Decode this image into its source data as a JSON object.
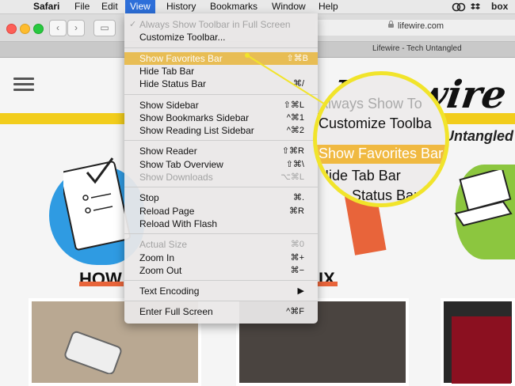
{
  "menubar": {
    "apple_glyph": "",
    "app_name": "Safari",
    "items": [
      "File",
      "Edit",
      "View",
      "History",
      "Bookmarks",
      "Window",
      "Help"
    ],
    "active": "View",
    "status_box": "box"
  },
  "toolbar": {
    "back_glyph": "‹",
    "forward_glyph": "›",
    "sidebar_glyph": "▭",
    "url": "lifewire.com",
    "tab_title": "Lifewire - Tech Untangled"
  },
  "page": {
    "logo_text": "Lifewire",
    "tagline": "Untangled",
    "heading_left": "HOW",
    "heading_right": "IX"
  },
  "view_menu": {
    "groups": [
      [
        {
          "label": "Always Show Toolbar in Full Screen",
          "shortcut": "",
          "disabled": true,
          "checked": true
        },
        {
          "label": "Customize Toolbar...",
          "shortcut": ""
        }
      ],
      [
        {
          "label": "Show Favorites Bar",
          "shortcut": "⇧⌘B",
          "highlighted": true
        },
        {
          "label": "Hide Tab Bar",
          "shortcut": ""
        },
        {
          "label": "Hide Status Bar",
          "shortcut": "⌘/"
        }
      ],
      [
        {
          "label": "Show Sidebar",
          "shortcut": "⇧⌘L"
        },
        {
          "label": "Show Bookmarks Sidebar",
          "shortcut": "^⌘1"
        },
        {
          "label": "Show Reading List Sidebar",
          "shortcut": "^⌘2"
        }
      ],
      [
        {
          "label": "Show Reader",
          "shortcut": "⇧⌘R"
        },
        {
          "label": "Show Tab Overview",
          "shortcut": "⇧⌘\\"
        },
        {
          "label": "Show Downloads",
          "shortcut": "⌥⌘L",
          "disabled": true
        }
      ],
      [
        {
          "label": "Stop",
          "shortcut": "⌘."
        },
        {
          "label": "Reload Page",
          "shortcut": "⌘R"
        },
        {
          "label": "Reload With Flash",
          "shortcut": ""
        }
      ],
      [
        {
          "label": "Actual Size",
          "shortcut": "⌘0",
          "disabled": true
        },
        {
          "label": "Zoom In",
          "shortcut": "⌘+"
        },
        {
          "label": "Zoom Out",
          "shortcut": "⌘−"
        }
      ],
      [
        {
          "label": "Text Encoding",
          "shortcut": "▶"
        }
      ],
      [
        {
          "label": "Enter Full Screen",
          "shortcut": "^⌘F"
        }
      ]
    ]
  },
  "magnifier": {
    "lines": [
      "Always Show To",
      "Customize Toolba",
      "Show Favorites Bar",
      "Hide Tab Bar",
      "Hide Status Bar"
    ]
  },
  "colors": {
    "highlight": "#e8b945",
    "callout": "#f1e42b",
    "brand_yellow": "#f2cd1c",
    "menubar_active": "#2d6fd9"
  }
}
